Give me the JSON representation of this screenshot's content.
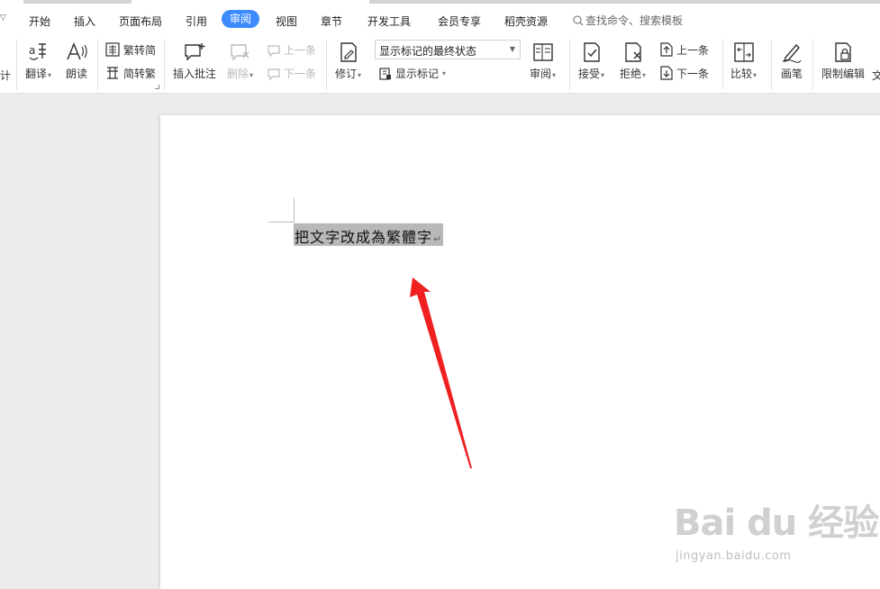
{
  "menu": {
    "tabs": [
      "开始",
      "插入",
      "页面布局",
      "引用",
      "审阅",
      "视图",
      "章节",
      "开发工具",
      "会员专享",
      "稻壳资源"
    ],
    "active_tab": "审阅",
    "search_placeholder": "查找命令、搜索模板"
  },
  "ribbon": {
    "cut_label": "计",
    "translate": "翻译",
    "read_aloud": "朗读",
    "trad_to_simp": "繁转简",
    "simp_to_trad": "简转繁",
    "insert_comment": "插入批注",
    "delete": "删除",
    "prev_comment": "上一条",
    "next_comment": "下一条",
    "track_changes": "修订",
    "markup_mode": "显示标记的最终状态",
    "show_markup": "显示标记",
    "review": "审阅",
    "accept": "接受",
    "reject": "拒绝",
    "prev_change": "上一条",
    "next_change": "下一条",
    "compare": "比较",
    "pen": "画笔",
    "restrict_editing": "限制编辑",
    "doc_protect_partial": "文"
  },
  "document": {
    "selected_text": "把文字改成為繁體字"
  },
  "watermark": {
    "logo": "Bai du 经验",
    "url": "jingyan.baidu.com"
  },
  "colors": {
    "accent": "#3d8bfd",
    "arrow": "#f02020",
    "selection": "#b8b8b8"
  }
}
